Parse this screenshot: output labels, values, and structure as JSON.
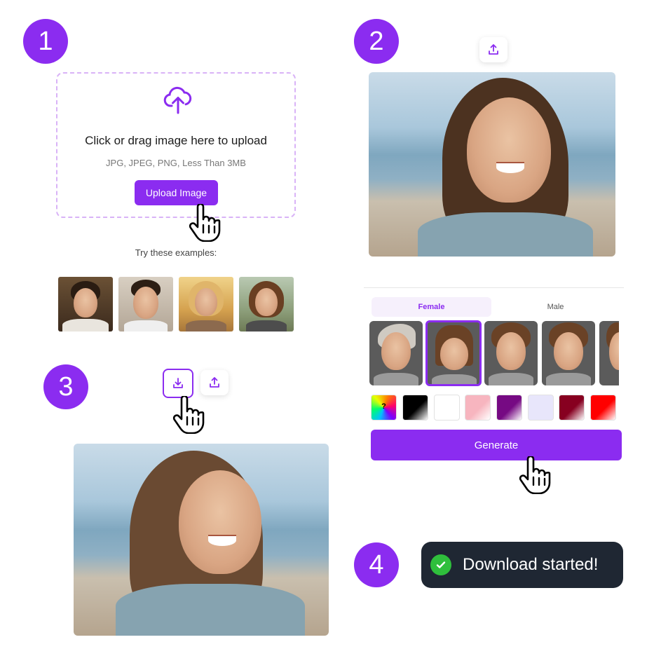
{
  "steps": {
    "one": "1",
    "two": "2",
    "three": "3",
    "four": "4"
  },
  "upload": {
    "title": "Click or drag image here to upload",
    "subtitle": "JPG, JPEG, PNG, Less Than 3MB",
    "button_label": "Upload Image",
    "icon": "cloud-upload-icon"
  },
  "examples": {
    "label": "Try these examples:"
  },
  "editor": {
    "tabs": [
      {
        "label": "Female",
        "active": true
      },
      {
        "label": "Male",
        "active": false
      }
    ],
    "generate_label": "Generate",
    "color_swatches": [
      "custom",
      "#000000",
      "#ffffff",
      "#f9c0c8",
      "#7a0a84",
      "#e8e6fb",
      "#8a0021",
      "#ff0000"
    ],
    "custom_swatch_label": "?"
  },
  "toast": {
    "text": "Download started!"
  },
  "colors": {
    "accent": "#8b2cf0",
    "toast_bg": "#1f2733",
    "success": "#2fbf3c"
  }
}
